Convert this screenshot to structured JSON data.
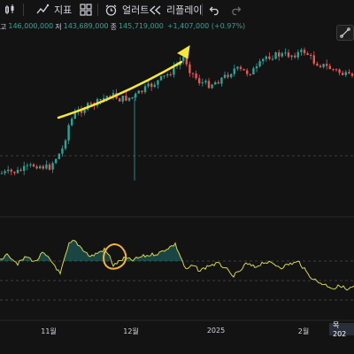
{
  "toolbar": {
    "indicators_label": "지표",
    "alert_label": "얼러트",
    "replay_label": "리플레이"
  },
  "ohlc": {
    "high_prefix": "고",
    "high_value": "146,000,000",
    "low_prefix": "저",
    "low_value": "143,689,000",
    "close_prefix": "종",
    "close_value": "145,719,000",
    "change": "+1,407,000 (+0.97%)"
  },
  "xaxis": {
    "labels": [
      "11월",
      "12월",
      "2025",
      "2월"
    ],
    "current_date_badge": "목 202"
  },
  "colors": {
    "background": "#131313",
    "up": "#26a69a",
    "down": "#ef5350",
    "oscillator": "#d4d44a",
    "annotation": "#f5e63a",
    "circle": "#f5b23a"
  },
  "annotations": {
    "arrow": "yellow hand-drawn arrow pointing up-right along the uptrend",
    "circle": "orange hand-drawn circle around oscillator dip"
  }
}
